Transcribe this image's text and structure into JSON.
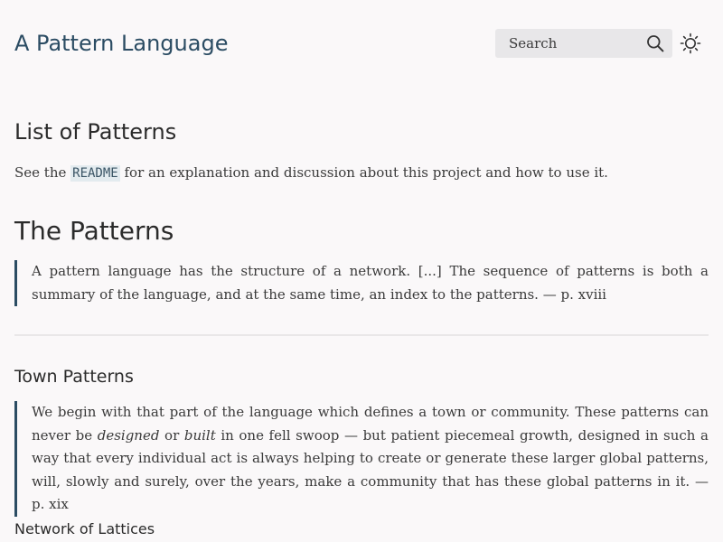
{
  "header": {
    "site_title": "A Pattern Language",
    "search_placeholder": "Search"
  },
  "list_section": {
    "heading": "List of Patterns",
    "intro_before": "See the ",
    "readme_link": "README",
    "intro_after": " for an explanation and discussion about this project and how to use it."
  },
  "patterns_section": {
    "heading": "The Patterns",
    "quote": "A pattern language has the structure of a network. [...] The sequence of patterns is both a summary of the language, and at the same time, an index to the patterns. — p. xviii"
  },
  "town_section": {
    "heading": "Town Patterns",
    "quote_part1": "We begin with that part of the language which defines a town or community. These patterns can never be ",
    "quote_em1": "designed",
    "quote_part2": " or ",
    "quote_em2": "built",
    "quote_part3": " in one fell swoop — but patient piecemeal growth, designed in such a way that every individual act is always helping to create or generate these larger global patterns, will, slowly and surely, over the years, make a community that has these global patterns in it. — p. xix"
  },
  "next_heading": "Network of Lattices",
  "colors": {
    "accent": "#2b4c63",
    "background": "#faf8f9",
    "search_bg": "#e8e7e9",
    "code_bg": "#e3ebef"
  },
  "icons": {
    "search": "search-icon",
    "theme": "sun-icon"
  }
}
